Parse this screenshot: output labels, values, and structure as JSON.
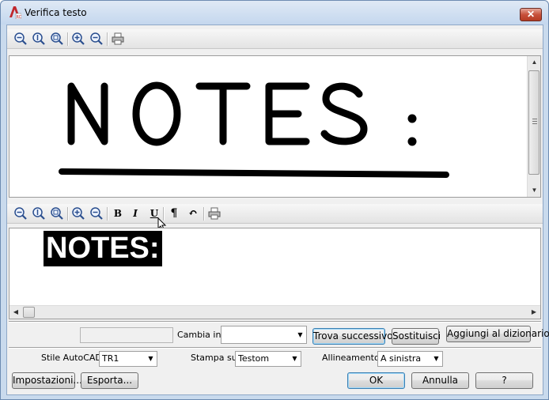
{
  "window": {
    "title": "Verifica testo",
    "close_label": "✕"
  },
  "image_toolbar": {
    "icons": [
      "zoom-out-icon",
      "zoom-extents-icon",
      "zoom-window-icon",
      "zoom-in-icon",
      "zoom-out-small-icon",
      "print-icon"
    ]
  },
  "image_pane": {
    "content": "NOTES:"
  },
  "text_toolbar": {
    "bold": "B",
    "italic": "I",
    "underline": "U",
    "paragraph": "¶",
    "undo": "↶"
  },
  "text_pane": {
    "recognized_text": "NOTES:"
  },
  "correction_row": {
    "replace_label": "Cambia in:",
    "replace_value": "",
    "find_next": "Trova successivo",
    "replace": "Sostituisci",
    "add_to_dictionary": "Aggiungi al dizionario"
  },
  "options_row": {
    "style_label": "Stile AutoCAD:",
    "style_value": "TR1",
    "print_label": "Stampa su:",
    "print_value": "Testom",
    "align_label": "Allineamento:",
    "align_value": "A sinistra"
  },
  "footer": {
    "settings": "Impostazioni...",
    "export": "Esporta...",
    "ok": "OK",
    "cancel": "Annulla",
    "help": "?"
  }
}
